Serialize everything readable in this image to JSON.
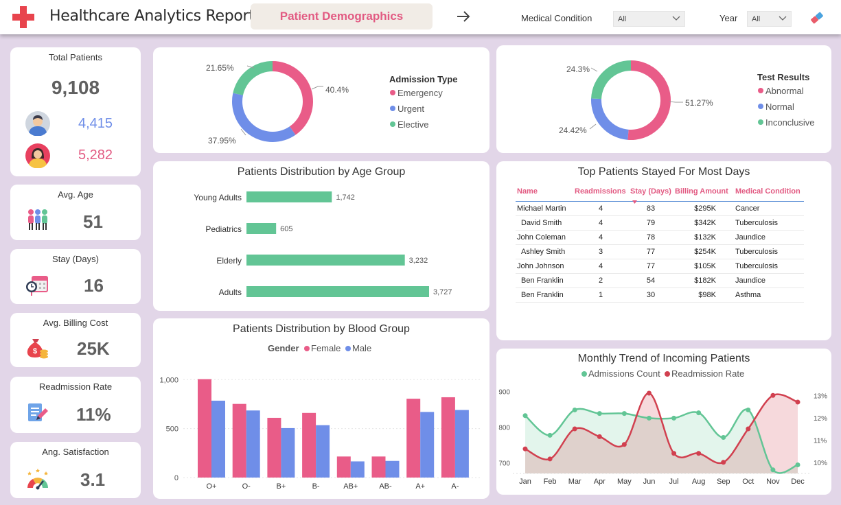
{
  "header": {
    "title": "Healthcare Analytics Report",
    "tab_label": "Patient Demographics",
    "filters": [
      {
        "label": "Medical Condition",
        "value": "All"
      },
      {
        "label": "Year",
        "value": "All"
      }
    ]
  },
  "kpis": {
    "total_patients": {
      "title": "Total Patients",
      "value": "9,108",
      "male": "4,415",
      "female": "5,282"
    },
    "avg_age": {
      "title": "Avg. Age",
      "value": "51"
    },
    "stay": {
      "title": "Stay (Days)",
      "value": "16"
    },
    "billing": {
      "title": "Avg. Billing Cost",
      "value": "25K"
    },
    "readmission": {
      "title": "Readmission Rate",
      "value": "11%"
    },
    "satisfaction": {
      "title": "Ang. Satisfaction",
      "value": "3.1"
    }
  },
  "colors": {
    "pink": "#e95c88",
    "blue": "#6f8ee8",
    "green": "#62c595",
    "red": "#d1404f",
    "accent": "#e25a82"
  },
  "chart_data": [
    {
      "type": "pie",
      "legend_title": "Admission Type",
      "categories": [
        "Emergency",
        "Urgent",
        "Elective"
      ],
      "values": [
        40.4,
        37.95,
        21.65
      ],
      "labels": [
        "40.4%",
        "37.95%",
        "21.65%"
      ]
    },
    {
      "type": "pie",
      "legend_title": "Test Results",
      "categories": [
        "Abnormal",
        "Normal",
        "Inconclusive"
      ],
      "values": [
        51.27,
        24.42,
        24.3
      ],
      "labels": [
        "51.27%",
        "24.42%",
        "24.3%"
      ]
    },
    {
      "type": "bar",
      "title": "Patients Distribution by Age Group",
      "categories": [
        "Young Adults",
        "Pediatrics",
        "Elderly",
        "Adults"
      ],
      "values": [
        1742,
        605,
        3232,
        3727
      ],
      "value_labels": [
        "1,742",
        "605",
        "3,232",
        "3,727"
      ]
    },
    {
      "type": "bar",
      "title": "Patients Distribution by Blood Group",
      "legend_title": "Gender",
      "categories": [
        "O+",
        "O-",
        "B+",
        "B-",
        "AB+",
        "AB-",
        "A+",
        "A-"
      ],
      "series": [
        {
          "name": "Female",
          "values": [
            1005,
            752,
            610,
            660,
            215,
            215,
            805,
            820
          ]
        },
        {
          "name": "Male",
          "values": [
            785,
            685,
            505,
            535,
            165,
            170,
            670,
            690
          ]
        }
      ],
      "ylim": [
        0,
        1100
      ],
      "yticks": [
        "0",
        "500",
        "1,000"
      ]
    },
    {
      "type": "line",
      "title": "Monthly Trend of Incoming Patients",
      "categories": [
        "Jan",
        "Feb",
        "Mar",
        "Apr",
        "May",
        "Jun",
        "Jul",
        "Aug",
        "Sep",
        "Oct",
        "Nov",
        "Dec"
      ],
      "series": [
        {
          "name": "Admissions Count",
          "values": [
            832,
            777,
            848,
            838,
            838,
            825,
            825,
            840,
            771,
            848,
            680,
            694
          ]
        },
        {
          "name": "Readmission Rate",
          "values": [
            10.6,
            10.15,
            11.5,
            11.15,
            10.8,
            13.1,
            10.4,
            10.4,
            10.0,
            11.5,
            13.0,
            12.7
          ]
        }
      ],
      "y_left": {
        "ylim": [
          670,
          920
        ],
        "ticks": [
          "700",
          "800",
          "900"
        ]
      },
      "y_right": {
        "ylim": [
          9.5,
          13.5
        ],
        "ticks": [
          "10%",
          "11%",
          "12%",
          "13%"
        ]
      }
    }
  ],
  "table": {
    "title": "Top Patients Stayed For Most Days",
    "columns": [
      "Name",
      "Readmissions",
      "Stay (Days)",
      "Billing Amount",
      "Medical Condition"
    ],
    "rows": [
      [
        "Michael Martin",
        "4",
        "83",
        "$295K",
        "Cancer"
      ],
      [
        "David Smith",
        "4",
        "79",
        "$342K",
        "Tuberculosis"
      ],
      [
        "John Coleman",
        "4",
        "78",
        "$132K",
        "Jaundice"
      ],
      [
        "Ashley Smith",
        "3",
        "77",
        "$254K",
        "Tuberculosis"
      ],
      [
        "John Johnson",
        "4",
        "77",
        "$105K",
        "Tuberculosis"
      ],
      [
        "Ben Franklin",
        "2",
        "54",
        "$182K",
        "Jaundice"
      ],
      [
        "Ben Franklin",
        "1",
        "30",
        "$98K",
        "Asthma"
      ]
    ]
  }
}
